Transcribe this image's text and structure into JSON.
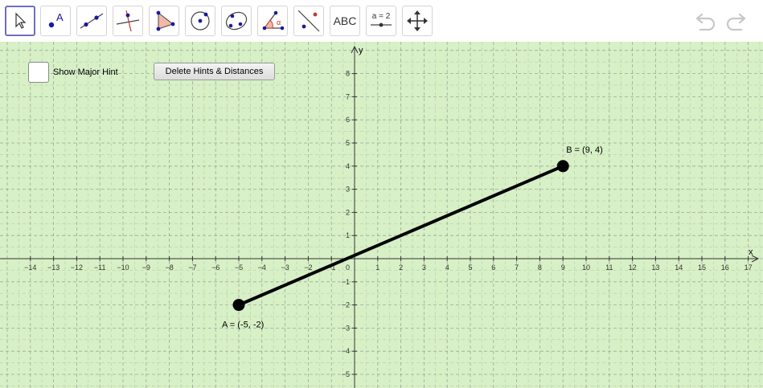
{
  "toolbar": {
    "tools": [
      {
        "name": "move-tool",
        "label": ""
      },
      {
        "name": "point-tool",
        "label": "A"
      },
      {
        "name": "line-tool",
        "label": ""
      },
      {
        "name": "perpendicular-line-tool",
        "label": ""
      },
      {
        "name": "polygon-tool",
        "label": ""
      },
      {
        "name": "circle-center-point-tool",
        "label": ""
      },
      {
        "name": "conic-tool",
        "label": ""
      },
      {
        "name": "angle-tool",
        "label": "α"
      },
      {
        "name": "reflect-tool",
        "label": ""
      },
      {
        "name": "text-tool",
        "label": "ABC"
      },
      {
        "name": "slider-tool",
        "label": "a = 2"
      },
      {
        "name": "move-graphics-view-tool",
        "label": ""
      }
    ],
    "undo_icon": "undo-icon",
    "redo_icon": "redo-icon"
  },
  "controls": {
    "checkbox_label": "Show Major Hint",
    "checkbox_checked": false,
    "delete_button_label": "Delete Hints & Distances"
  },
  "graph": {
    "x_axis_label": "x",
    "y_axis_label": "y",
    "x_ticks": [
      -14,
      -13,
      -12,
      -11,
      -10,
      -9,
      -8,
      -7,
      -6,
      -5,
      -4,
      -3,
      -2,
      -1,
      0,
      1,
      2,
      3,
      4,
      5,
      6,
      7,
      8,
      9,
      10,
      11,
      12,
      13,
      14,
      15,
      16,
      17
    ],
    "y_ticks": [
      -5,
      -4,
      -3,
      -2,
      -1,
      1,
      2,
      3,
      4,
      5,
      6,
      7,
      8
    ],
    "origin_label": "0",
    "point_a": {
      "label": "A = (-5, -2)",
      "x": -5,
      "y": -2
    },
    "point_b": {
      "label": "B = (9, 4)",
      "x": 9,
      "y": 4
    },
    "colors": {
      "background": "#d7f0c6",
      "grid": "#8a8a8a",
      "segment": "#000000"
    }
  }
}
